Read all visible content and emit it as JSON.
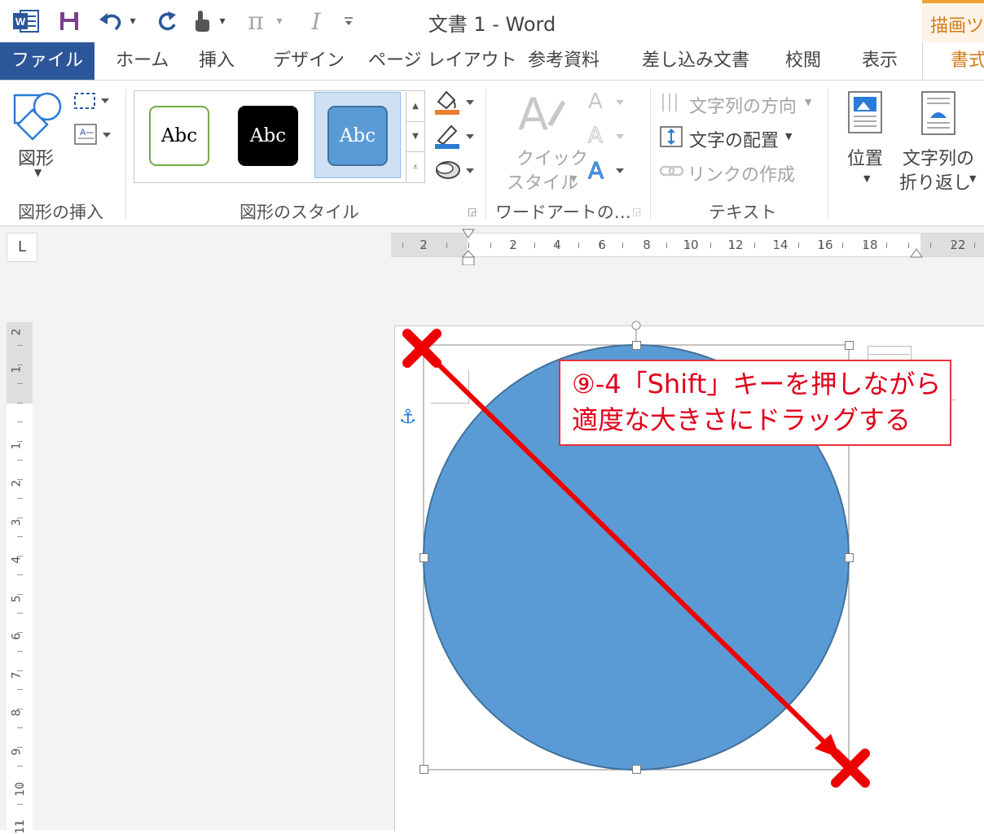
{
  "window": {
    "title": "文書 1 - Word",
    "context_tab_label": "描画ツール",
    "accent_color": "#2b579a",
    "context_color": "#d27d16"
  },
  "quick_access": {
    "icons": [
      "word-icon",
      "save-icon",
      "undo-icon",
      "redo-icon",
      "touch-mode-icon",
      "equation-icon",
      "italic-icon",
      "customize-icon"
    ],
    "undo_arrow": "▾",
    "touch_arrow": "▾",
    "pi_label": "π",
    "pi_arrow": "▾",
    "italic_label": "I"
  },
  "tabs": [
    {
      "label": "ファイル"
    },
    {
      "label": "ホーム"
    },
    {
      "label": "挿入"
    },
    {
      "label": "デザイン"
    },
    {
      "label": "ページ レイアウト"
    },
    {
      "label": "参考資料"
    },
    {
      "label": "差し込み文書"
    },
    {
      "label": "校閲"
    },
    {
      "label": "表示"
    },
    {
      "label": "書式"
    }
  ],
  "ribbon": {
    "insert_shapes": {
      "shapes_label": "図形",
      "group_label": "図形の挿入"
    },
    "shape_styles": {
      "styles": [
        {
          "label": "Abc",
          "fill": "#ffffff",
          "border": "#70ad47",
          "text": "#000000"
        },
        {
          "label": "Abc",
          "fill": "#000000",
          "border": "#000000",
          "text": "#ffffff"
        },
        {
          "label": "Abc",
          "fill": "#5b9bd5",
          "border": "#41719c",
          "text": "#ffffff"
        }
      ],
      "group_label": "図形のスタイル"
    },
    "wordart": {
      "quick_style_line1": "クイック",
      "quick_style_line2": "スタイル",
      "group_label": "ワードアートの…"
    },
    "text": {
      "direction_label": "文字列の方向",
      "align_label": "文字の配置",
      "link_label": "リンクの作成",
      "group_label": "テキスト"
    },
    "arrange": {
      "position_label": "位置",
      "wrap_line1": "文字列の",
      "wrap_line2": "折り返し"
    }
  },
  "ruler": {
    "h_ticks": [
      "2",
      "2",
      "4",
      "6",
      "8",
      "10",
      "12",
      "14",
      "16",
      "18",
      "22"
    ],
    "v_ticks": [
      "2",
      "1",
      "1",
      "2",
      "3",
      "4",
      "5",
      "6",
      "7",
      "8",
      "9",
      "10",
      "11"
    ],
    "tab_selector": "L"
  },
  "document": {
    "shape": {
      "type": "circle",
      "fill": "#5b9bd5",
      "stroke": "#41719c"
    },
    "annotation": {
      "line1": "⑨-4「Shift」キーを押しながら",
      "line2": "適度な大きさにドラッグする",
      "color": "#e0001b"
    }
  }
}
